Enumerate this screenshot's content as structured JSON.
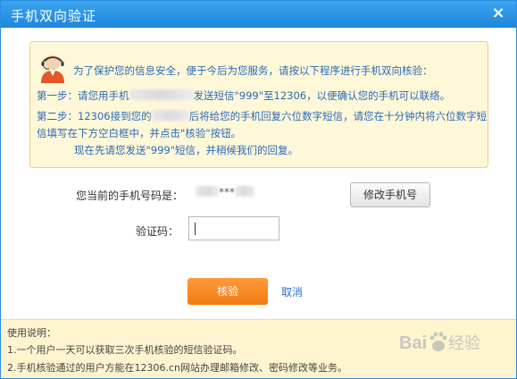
{
  "dialog": {
    "title": "手机双向验证",
    "close_icon": "close-icon",
    "close_glyph": "×"
  },
  "notice": {
    "avatar_icon": "customer-service-avatar-icon",
    "intro": "为了保护您的信息安全，便于今后为您服务，请按以下程序进行手机双向核验：",
    "step1_a": "第一步：请您用手机",
    "step1_b": "发送短信\"999\"至12306，以便确认您的手机可以联络。",
    "step2_a": "第二步：12306接到您的",
    "step2_b": "后将给您的手机回复六位数字短信，请您在十分钟内将六位数字短",
    "step2_c": "信填写在下方空白框中，并点击\"核验\"按钮。",
    "now": "现在先请您发送\"999\"短信，并稍候我们的回复。"
  },
  "form": {
    "phone_label": "您当前的手机号码是：",
    "phone_value": "***",
    "change_phone_button": "修改手机号",
    "code_label": "验证码：",
    "code_value": "",
    "verify_button": "核验",
    "cancel_link": "取消"
  },
  "footer": {
    "heading": "使用说明：",
    "line1": "1.一个用户一天可以获取三次手机核验的短信验证码。",
    "line2": "2.手机核验通过的用户方能在12306.cn网站办理邮箱修改、密码修改等业务。"
  },
  "watermark": {
    "text": "Bai 经验",
    "icon": "baidu-paw-logo"
  },
  "colors": {
    "title_bar": "#2b8ee0",
    "notice_bg": "#fff8d8",
    "notice_text": "#2a69b8",
    "verify_button": "#f58a1f",
    "footer_bg": "#fff4d0"
  }
}
